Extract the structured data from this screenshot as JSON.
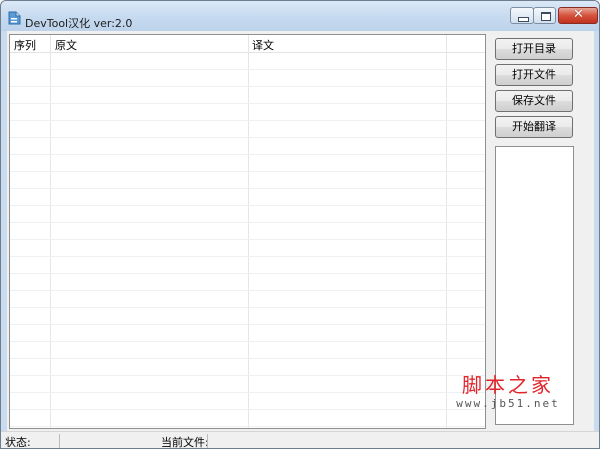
{
  "window": {
    "title": "DevTool汉化 ver:2.0"
  },
  "grid": {
    "columns": [
      "序列",
      "原文",
      "译文"
    ],
    "rows": []
  },
  "sidebar": {
    "buttons": [
      "打开目录",
      "打开文件",
      "保存文件",
      "开始翻译"
    ]
  },
  "watermark": {
    "main": "脚本之家",
    "url": "www.jb51.net"
  },
  "statusbar": {
    "status_label": "状态:",
    "status_value": "",
    "file_label": "当前文件:",
    "file_value": ""
  }
}
